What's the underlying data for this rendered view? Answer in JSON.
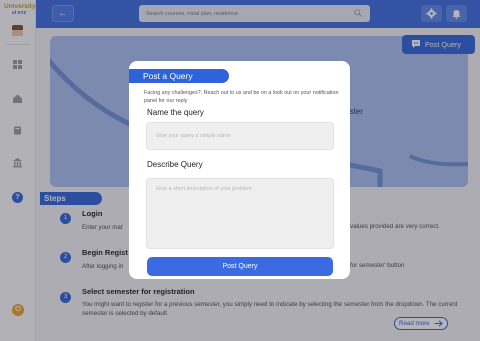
{
  "brand": {
    "name": "University",
    "subname": "of XYZ"
  },
  "search": {
    "placeholder": "Search courses, meal plan, residence"
  },
  "page": {
    "hero_text": "semester",
    "post_query_button": "Post Query",
    "steps_heading": "Steps",
    "steps": [
      {
        "num": "1",
        "title": "Login",
        "desc": "Enter your mat",
        "desc_tail": "values provided are very correct."
      },
      {
        "num": "2",
        "title": "Begin Regist",
        "desc": "After logging in",
        "desc_tail": "for semester' button"
      },
      {
        "num": "3",
        "title": "Select semester for registration",
        "desc": "You might want to register for a previous semester, you simply need to indicate by selecting the semester from the dropdown. The current semester is selected by default"
      }
    ],
    "read_more": "Read more"
  },
  "modal": {
    "title": "Post a Query",
    "subtitle": "Facing any challenges?, Reach out to us and be on a look out on your notification panel for our reply",
    "name_label": "Name the query",
    "name_placeholder": "Give your query a simple name",
    "describe_label": "Describe Query",
    "describe_placeholder": "Give a short description of your problem",
    "submit": "Post Query"
  },
  "colors": {
    "primary": "#3c6be1",
    "accent": "#2f63d9",
    "hero": "#a9bff0",
    "brand_gold": "#c99a2e"
  },
  "icons": [
    "back-arrow-icon",
    "search-icon",
    "gear-icon",
    "bell-icon",
    "dashboard-icon",
    "home-icon",
    "book-icon",
    "building-icon",
    "help-icon",
    "chat-icon",
    "arrow-right-icon"
  ]
}
